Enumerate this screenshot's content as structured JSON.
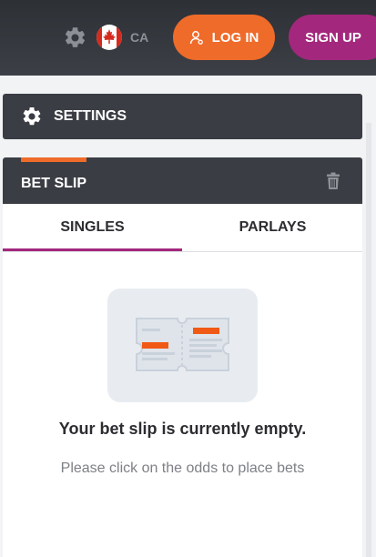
{
  "header": {
    "settings_icon": "gear-icon",
    "country_flag": "canada-flag-icon",
    "country_code": "CA",
    "login_label": "LOG IN",
    "signup_label": "SIGN UP"
  },
  "settings": {
    "label": "SETTINGS",
    "icon": "gear-icon"
  },
  "bet_slip": {
    "title": "BET SLIP",
    "delete_icon": "trash-icon",
    "tabs": [
      {
        "label": "SINGLES",
        "active": true
      },
      {
        "label": "PARLAYS",
        "active": false
      }
    ],
    "empty_illustration": "ticket-icon",
    "empty_title": "Your bet slip is currently empty.",
    "empty_subtitle": "Please click on the odds to place bets"
  },
  "colors": {
    "accent_orange": "#ef6b2a",
    "brand_purple": "#a3287d",
    "header_dark": "#3a3d43"
  }
}
